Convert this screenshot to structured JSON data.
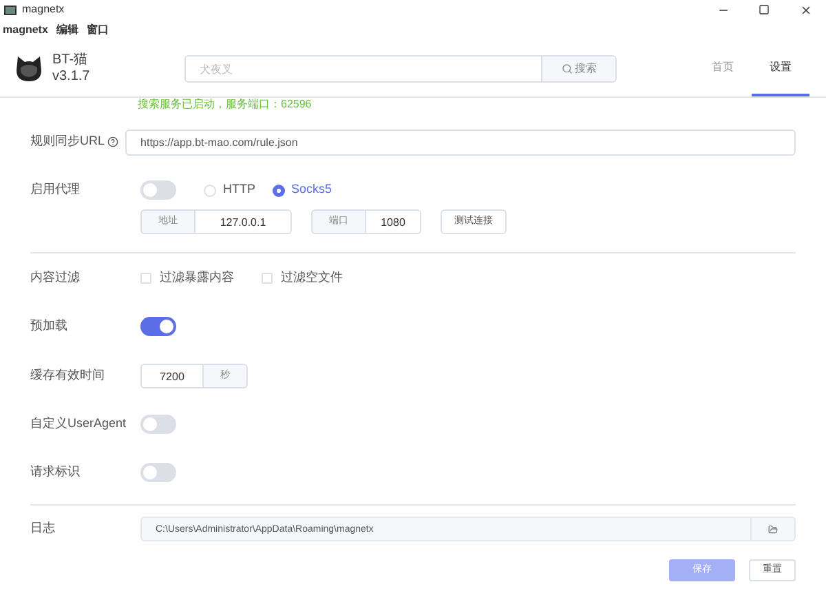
{
  "window": {
    "title": "magnetx"
  },
  "menu": [
    "magnetx",
    "编辑",
    "窗口"
  ],
  "app": {
    "name": "BT-猫",
    "version": "v3.1.7"
  },
  "search": {
    "placeholder": "犬夜叉",
    "button": "搜索"
  },
  "tabs": [
    {
      "label": "首页",
      "selected": false
    },
    {
      "label": "设置",
      "selected": true
    }
  ],
  "status": "搜索服务已启动，服务端口：62596",
  "settings": {
    "url": {
      "label": "规则同步URL",
      "value": "https://app.bt-mao.com/rule.json"
    },
    "proxy": {
      "label": "启用代理",
      "on": false,
      "options": [
        {
          "label": "HTTP",
          "selected": false
        },
        {
          "label": "Socks5",
          "selected": true
        }
      ],
      "address_label": "地址",
      "address": "127.0.0.1",
      "port_label": "端口",
      "port": "1080",
      "test_button": "测试连接"
    },
    "filter": {
      "label": "内容过滤",
      "options": [
        {
          "label": "过滤暴露内容",
          "checked": false
        },
        {
          "label": "过滤空文件",
          "checked": false
        }
      ]
    },
    "preload": {
      "label": "预加载",
      "on": true
    },
    "cache": {
      "label": "缓存有效时间",
      "value": "7200",
      "unit": "秒"
    },
    "user_agent": {
      "label": "自定义UserAgent",
      "on": false
    },
    "request_id": {
      "label": "请求标识",
      "on": false
    },
    "log": {
      "label": "日志",
      "value": "C:\\Users\\Administrator\\AppData\\Roaming\\magnetx"
    }
  },
  "buttons": {
    "save": "保存",
    "reset": "重置"
  }
}
